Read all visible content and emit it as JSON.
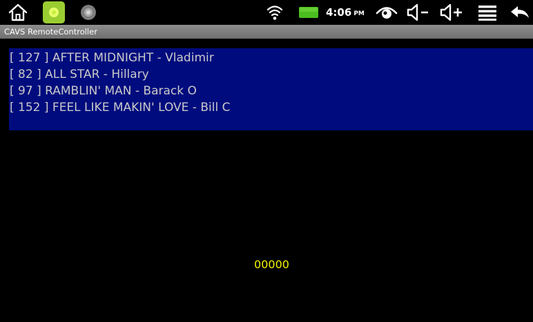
{
  "status_bar": {
    "icons": {
      "home": "home-icon",
      "app_green": "green-circle-app-icon",
      "app_gray": "gray-circle-app-icon",
      "wifi": "wifi-icon",
      "battery": "battery-icon",
      "eye": "eye-icon",
      "volume_down": "volume-down-icon",
      "volume_up": "volume-up-icon",
      "menu": "menu-icon",
      "back": "back-icon"
    },
    "time": "4:06",
    "ampm": "PM"
  },
  "app": {
    "title": "CAVS RemoteController"
  },
  "playlist": {
    "items": [
      "[ 127 ] AFTER MIDNIGHT - Vladimir",
      "[ 82 ] ALL STAR - Hillary",
      "[ 97 ] RAMBLIN' MAN - Barack O",
      "[ 152 ] FEEL LIKE MAKIN' LOVE - Bill C"
    ]
  },
  "counter": "00000",
  "colors": {
    "background": "#000000",
    "playlist_bg": "#000c7e",
    "playlist_text": "#c9c9c9",
    "counter_text": "#f2f200",
    "title_bar": "#7e7e7e",
    "accent_green": "#9acd32"
  }
}
